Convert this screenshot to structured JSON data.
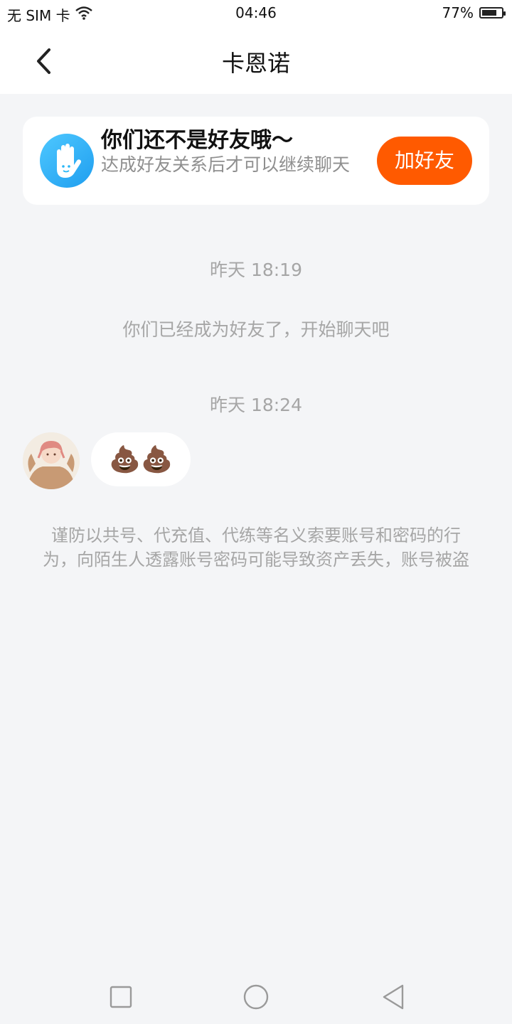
{
  "status_bar": {
    "carrier": "无 SIM 卡",
    "time": "04:46",
    "battery": "77%",
    "battery_level": 0.77
  },
  "header": {
    "title": "卡恩诺"
  },
  "friend_banner": {
    "title": "你们还不是好友哦～",
    "subtitle": "达成好友关系后才可以继续聊天",
    "button_label": "加好友",
    "accent": "#ff5a00"
  },
  "chat": {
    "timestamps": [
      "昨天 18:19",
      "昨天 18:24"
    ],
    "system_message": "你们已经成为好友了，开始聊天吧",
    "message": {
      "content": "💩💩"
    },
    "warning": "谨防以共号、代充值、代练等名义索要账号和密码的行为，向陌生人透露账号密码可能导致资产丢失，账号被盗"
  },
  "colors": {
    "background": "#f4f5f7",
    "muted_text": "#a6a6a6",
    "icon_blue": "#29b6f6"
  }
}
